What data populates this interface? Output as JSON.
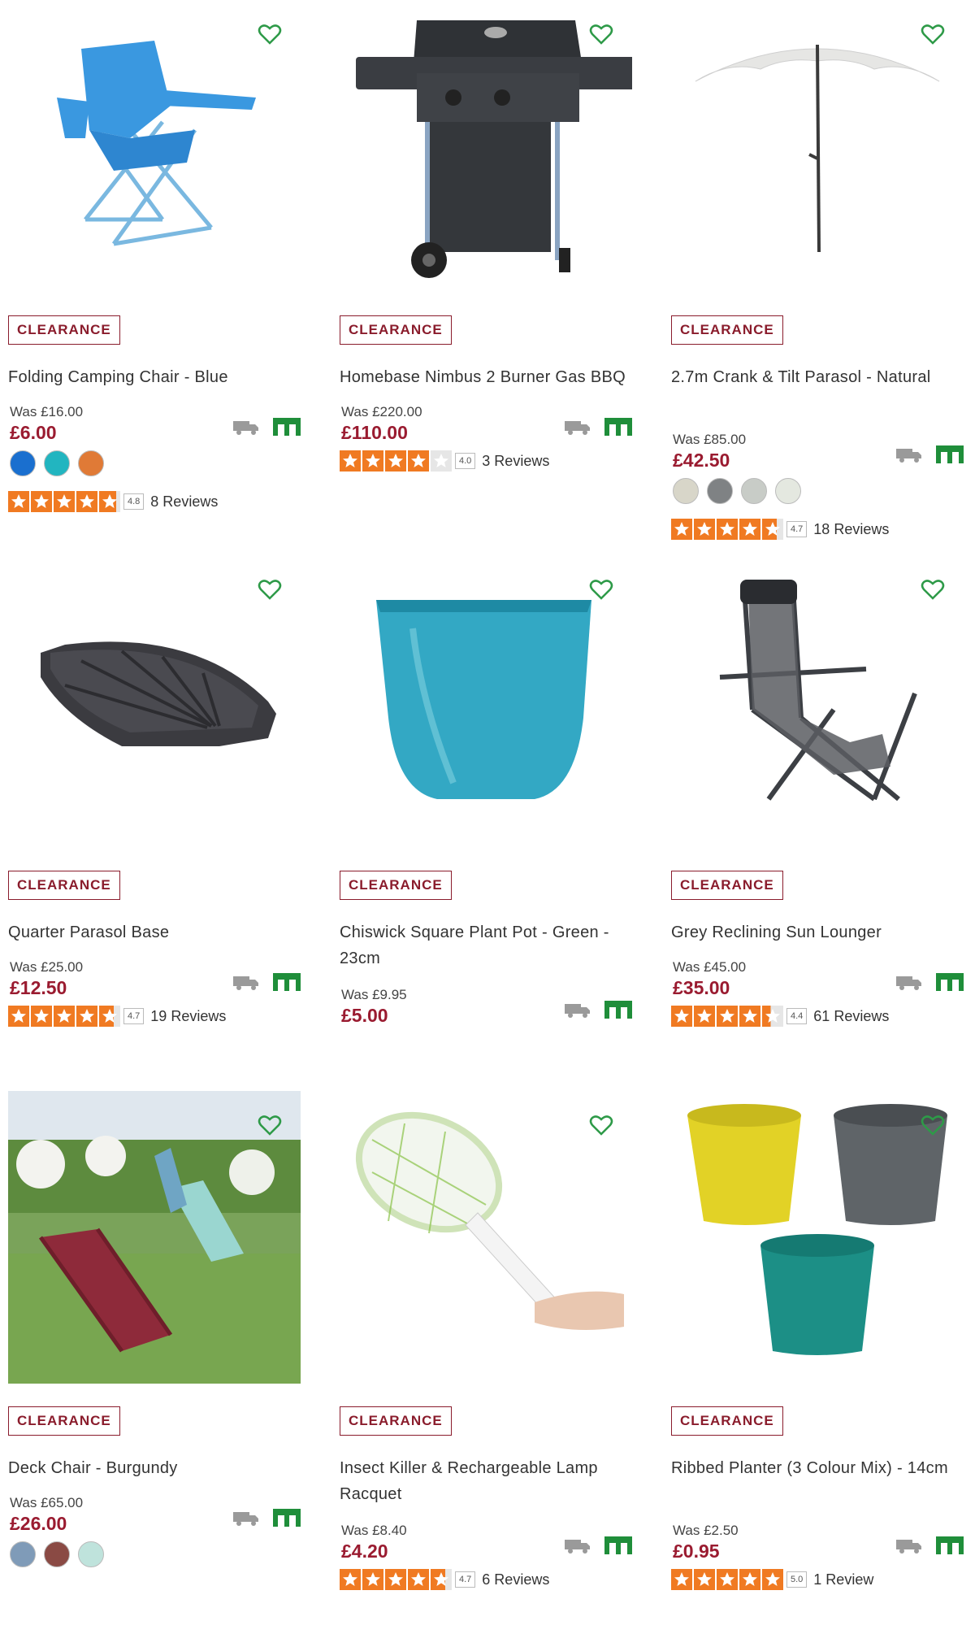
{
  "badge_label": "CLEARANCE",
  "colors": {
    "badge": "#8a1c2c",
    "price": "#9a1b30",
    "heart": "#2e9a48",
    "star": "#f07a22",
    "collect": "#1f8e3a",
    "truck": "#9a9a9a"
  },
  "products": [
    {
      "name": "Folding Camping Chair - Blue",
      "was": "Was £16.00",
      "price": "£6.00",
      "swatches": [
        "#1a6fcf",
        "#22b5c0",
        "#e07a36"
      ],
      "stars": 4.8,
      "score": "4.8",
      "reviews": "8 Reviews",
      "icon": "camping-chair"
    },
    {
      "name": "Homebase Nimbus 2 Burner Gas BBQ",
      "was": "Was £220.00",
      "price": "£110.00",
      "swatches": [],
      "stars": 4.0,
      "score": "4.0",
      "reviews": "3 Reviews",
      "icon": "gas-bbq"
    },
    {
      "name": "2.7m Crank & Tilt Parasol - Natural",
      "was": "Was £85.00",
      "price": "£42.50",
      "swatches": [
        "#d8d6c9",
        "#7f8284",
        "#c8ccc7",
        "#e4e8e0"
      ],
      "stars": 4.7,
      "score": "4.7",
      "reviews": "18 Reviews",
      "icon": "parasol"
    },
    {
      "name": "Quarter Parasol Base",
      "was": "Was £25.00",
      "price": "£12.50",
      "swatches": [],
      "stars": 4.7,
      "score": "4.7",
      "reviews": "19 Reviews",
      "icon": "parasol-base"
    },
    {
      "name": "Chiswick Square Plant Pot - Green - 23cm",
      "was": "Was £9.95",
      "price": "£5.00",
      "swatches": [],
      "stars": null,
      "score": "",
      "reviews": "",
      "icon": "plant-pot"
    },
    {
      "name": "Grey Reclining Sun Lounger",
      "was": "Was £45.00",
      "price": "£35.00",
      "swatches": [],
      "stars": 4.4,
      "score": "4.4",
      "reviews": "61 Reviews",
      "icon": "sun-lounger"
    },
    {
      "name": "Deck Chair - Burgundy",
      "was": "Was £65.00",
      "price": "£26.00",
      "swatches": [
        "#7f9bb8",
        "#8a4a44",
        "#bfe3dc"
      ],
      "stars": null,
      "score": "",
      "reviews": "",
      "icon": "deck-chair"
    },
    {
      "name": "Insect Killer & Rechargeable Lamp Racquet",
      "was": "Was £8.40",
      "price": "£4.20",
      "swatches": [],
      "stars": 4.7,
      "score": "4.7",
      "reviews": "6 Reviews",
      "icon": "insect-racquet"
    },
    {
      "name": "Ribbed Planter (3 Colour Mix) - 14cm",
      "was": "Was £2.50",
      "price": "£0.95",
      "swatches": [],
      "stars": 5.0,
      "score": "5.0",
      "reviews": "1 Review",
      "icon": "ribbed-planters"
    }
  ]
}
